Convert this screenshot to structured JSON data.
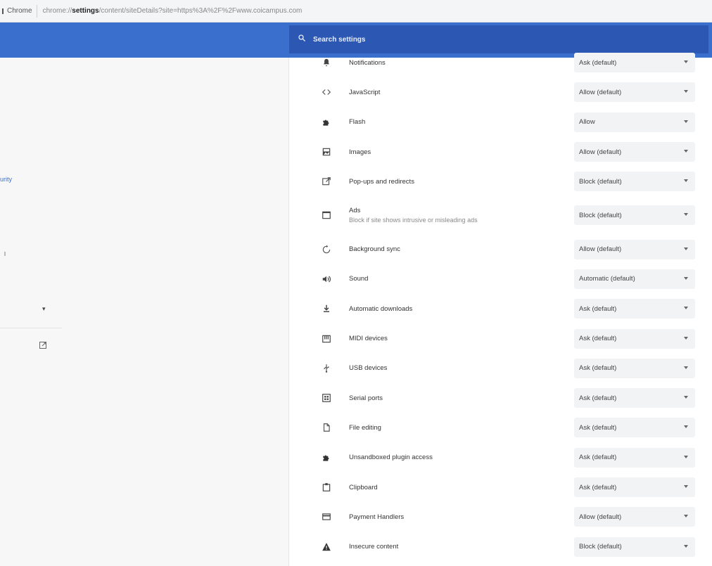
{
  "addressbar": {
    "site_chip": "Chrome",
    "url_prefix": "chrome://",
    "url_bold": "settings",
    "url_suffix": "/content/siteDetails?site=https%3A%2F%2Fwww.coicampus.com"
  },
  "header": {
    "search_placeholder": "Search settings",
    "color": "#3b6fce"
  },
  "sidebar": {
    "partial_label": "urity",
    "caret": "▾"
  },
  "permissions": [
    {
      "name": "notifications-row",
      "label": "Notifications",
      "icon": "bell-icon",
      "value": "Ask (default)"
    },
    {
      "name": "javascript-row",
      "label": "JavaScript",
      "icon": "code-icon",
      "value": "Allow (default)"
    },
    {
      "name": "flash-row",
      "label": "Flash",
      "icon": "puzzle-icon",
      "value": "Allow"
    },
    {
      "name": "images-row",
      "label": "Images",
      "icon": "image-icon",
      "value": "Allow (default)"
    },
    {
      "name": "popups-row",
      "label": "Pop-ups and redirects",
      "icon": "open-in-new-icon",
      "value": "Block (default)"
    },
    {
      "name": "ads-row",
      "label": "Ads",
      "sub": "Block if site shows intrusive or misleading ads",
      "icon": "ads-window-icon",
      "value": "Block (default)"
    },
    {
      "name": "background-sync-row",
      "label": "Background sync",
      "icon": "sync-icon",
      "value": "Allow (default)"
    },
    {
      "name": "sound-row",
      "label": "Sound",
      "icon": "speaker-icon",
      "value": "Automatic (default)"
    },
    {
      "name": "automatic-downloads-row",
      "label": "Automatic downloads",
      "icon": "download-icon",
      "value": "Ask (default)"
    },
    {
      "name": "midi-devices-row",
      "label": "MIDI devices",
      "icon": "piano-icon",
      "value": "Ask (default)"
    },
    {
      "name": "usb-devices-row",
      "label": "USB devices",
      "icon": "usb-icon",
      "value": "Ask (default)"
    },
    {
      "name": "serial-ports-row",
      "label": "Serial ports",
      "icon": "serial-port-icon",
      "value": "Ask (default)"
    },
    {
      "name": "file-editing-row",
      "label": "File editing",
      "icon": "file-edit-icon",
      "value": "Ask (default)"
    },
    {
      "name": "unsandboxed-plugin-row",
      "label": "Unsandboxed plugin access",
      "icon": "puzzle-icon",
      "value": "Ask (default)"
    },
    {
      "name": "clipboard-row",
      "label": "Clipboard",
      "icon": "clipboard-icon",
      "value": "Ask (default)"
    },
    {
      "name": "payment-handlers-row",
      "label": "Payment Handlers",
      "icon": "credit-card-icon",
      "value": "Allow (default)"
    },
    {
      "name": "insecure-content-row",
      "label": "Insecure content",
      "icon": "warning-icon",
      "value": "Block (default)"
    }
  ]
}
